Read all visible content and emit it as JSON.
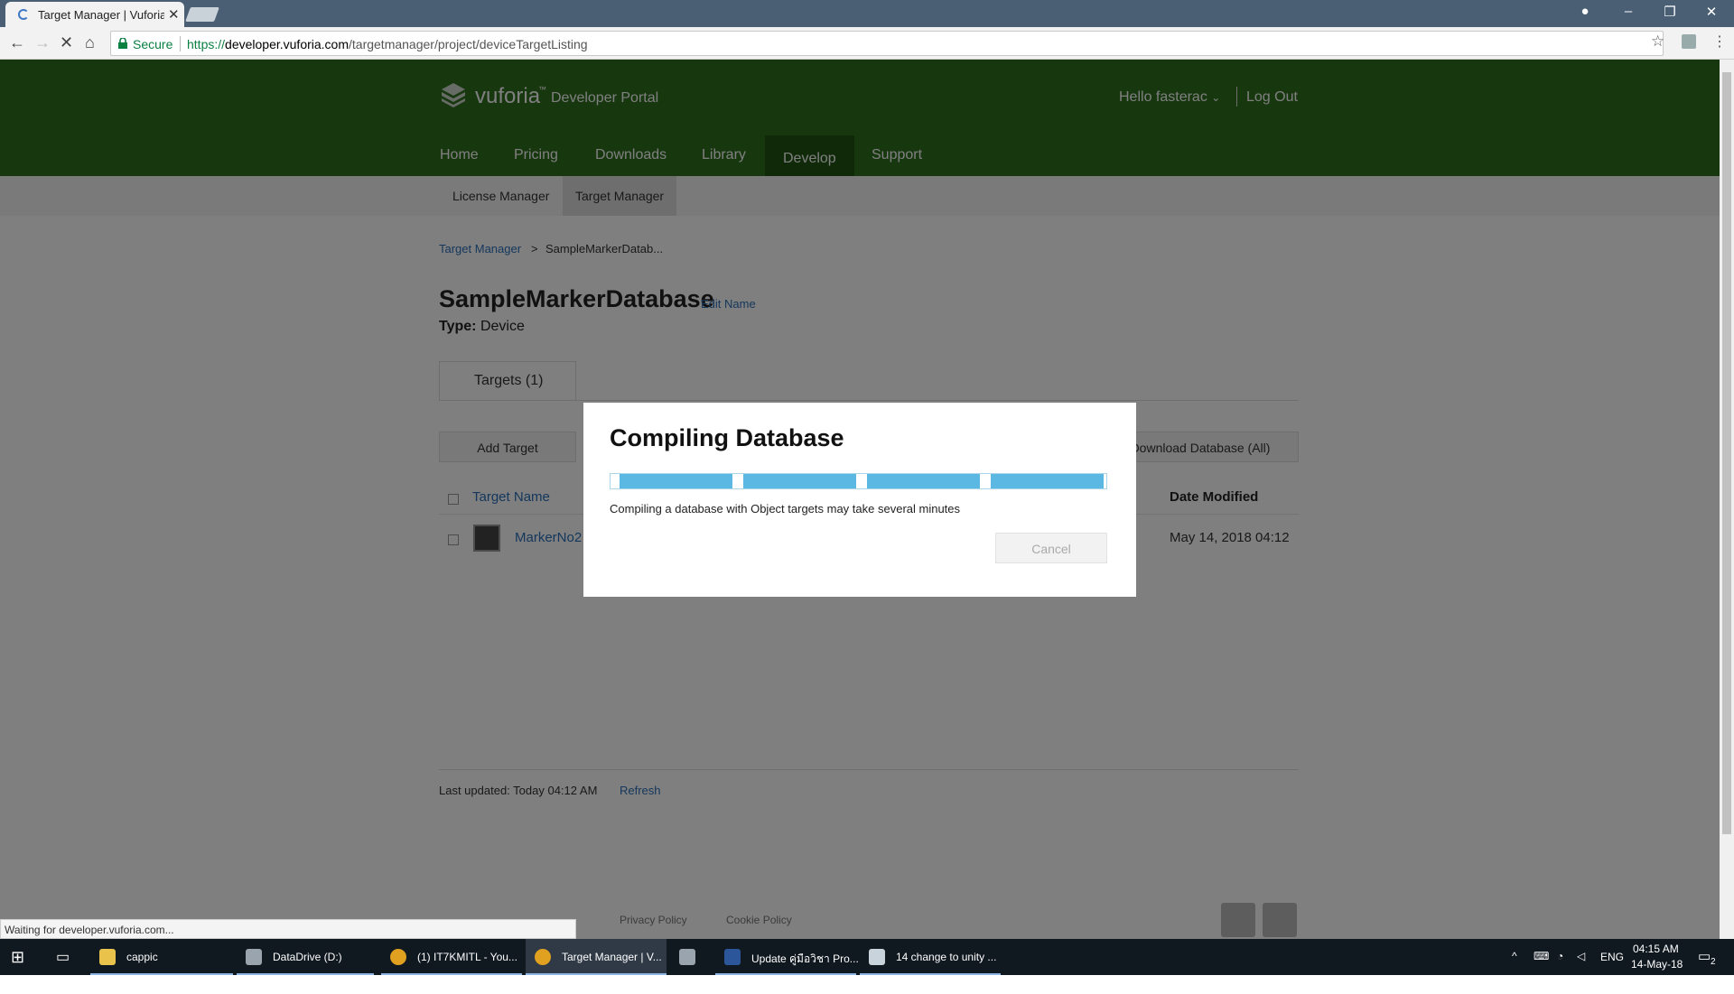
{
  "browser": {
    "tab_title": "Target Manager | Vuforia",
    "url_scheme": "https://",
    "url_host": "developer.vuforia.com",
    "url_path": "/targetmanager/project/deviceTargetListing",
    "secure_label": "Secure",
    "status_text": "Waiting for developer.vuforia.com..."
  },
  "header": {
    "logo_text": "vuforia",
    "logo_tm": "™",
    "logo_sub": "Developer Portal",
    "hello": "Hello fasterac",
    "logout": "Log Out",
    "nav": [
      "Home",
      "Pricing",
      "Downloads",
      "Library",
      "Develop",
      "Support"
    ]
  },
  "subnav": [
    "License Manager",
    "Target Manager"
  ],
  "breadcrumb": {
    "root": "Target Manager",
    "sep": ">",
    "current": "SampleMarkerDatab..."
  },
  "database": {
    "name": "SampleMarkerDatabase",
    "edit_label": "Edit Name",
    "type_label": "Type:",
    "type_value": "Device",
    "targets_tab": "Targets (1)",
    "add_target": "Add Target",
    "download": "Download Database (All)"
  },
  "table": {
    "col_name": "Target Name",
    "col_date": "Date Modified",
    "rows": [
      {
        "name": "MarkerNo2",
        "date": "May 14, 2018 04:12"
      }
    ]
  },
  "footer": {
    "last_updated": "Last updated: Today 04:12 AM",
    "refresh": "Refresh",
    "links": [
      "Privacy Policy",
      "Cookie Policy"
    ]
  },
  "modal": {
    "title": "Compiling Database",
    "message": "Compiling a database with Object targets may take several minutes",
    "cancel": "Cancel",
    "progress_fraction": 1.0
  },
  "taskbar": {
    "items": [
      "cappic",
      "DataDrive (D:)",
      "(1) IT7KMITL - You...",
      "Target Manager | V...",
      "",
      "Update คู่มือวิชา Pro...",
      "14 change to unity ..."
    ],
    "lang": "ENG",
    "time": "04:15 AM",
    "date": "14-May-18",
    "notif_count": "2"
  },
  "colors": {
    "header_green": "#2e6e1f",
    "progress_blue": "#5bb8e3",
    "link_blue": "#2a6fb8"
  }
}
